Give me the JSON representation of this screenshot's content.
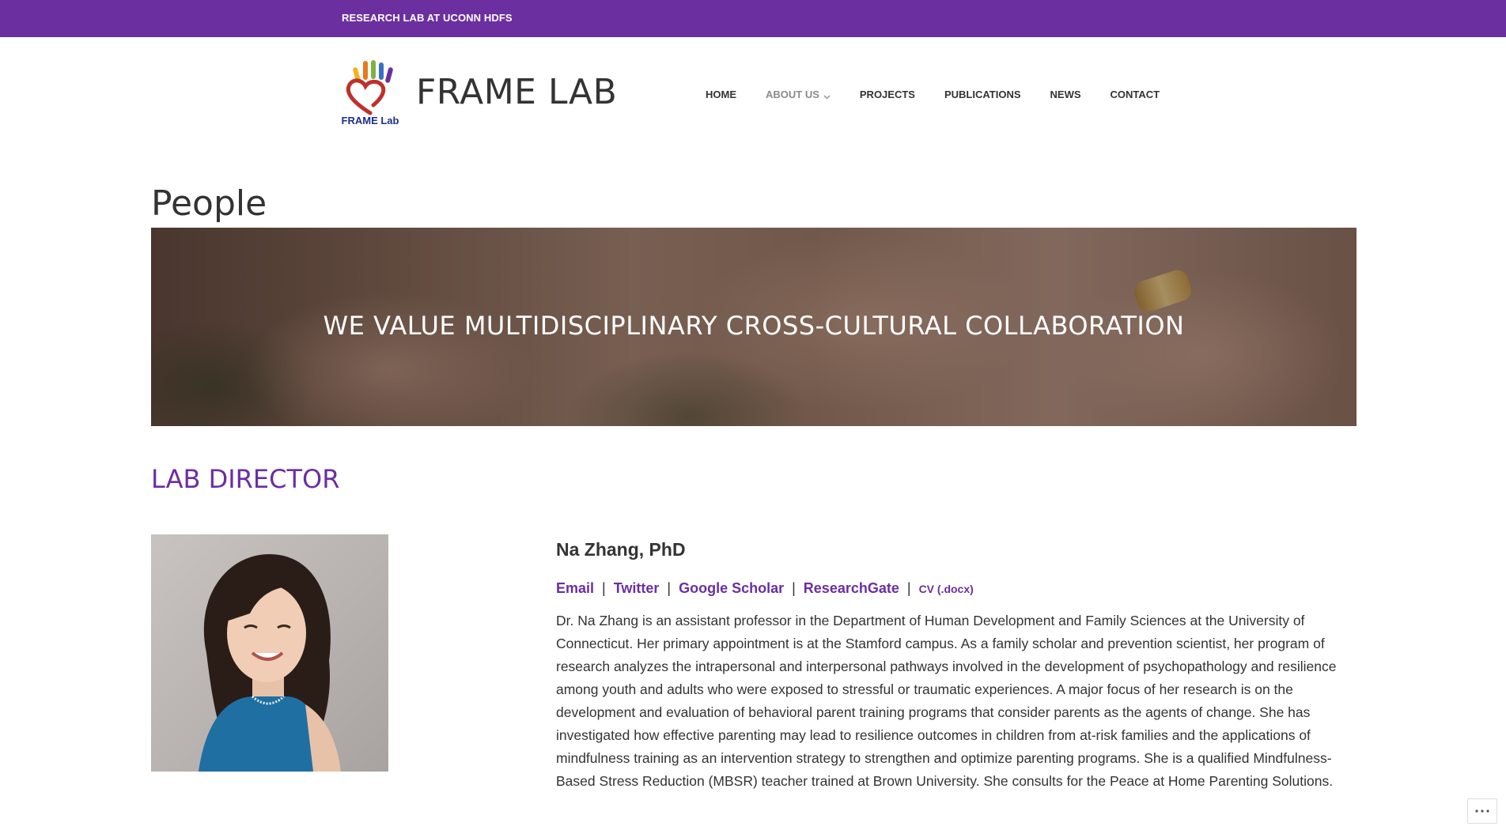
{
  "topbar": {
    "text": "RESEARCH LAB AT UCONN HDFS"
  },
  "header": {
    "logo_label": "FRAME Lab",
    "site_title": "FRAME LAB"
  },
  "nav": {
    "items": [
      {
        "label": "HOME"
      },
      {
        "label": "ABOUT US",
        "active": true,
        "has_dropdown": true
      },
      {
        "label": "PROJECTS"
      },
      {
        "label": "PUBLICATIONS"
      },
      {
        "label": "NEWS"
      },
      {
        "label": "CONTACT"
      }
    ]
  },
  "page": {
    "title": "People",
    "hero_text": "WE VALUE MULTIDISCIPLINARY CROSS-CULTURAL COLLABORATION",
    "section_title": "LAB DIRECTOR"
  },
  "director": {
    "name": "Na Zhang, PhD",
    "links": {
      "email": "Email",
      "twitter": "Twitter",
      "scholar": "Google Scholar",
      "researchgate": "ResearchGate",
      "cv": "CV (.docx)",
      "separator": "|"
    },
    "bio": "Dr. Na Zhang is an assistant professor in the Department of Human Development and Family Sciences at the University of Connecticut. Her primary appointment is at the Stamford campus. As a family scholar and prevention scientist, her program of research analyzes the intrapersonal and interpersonal pathways involved in the development of psychopathology and resilience among youth and adults who were exposed to stressful or traumatic experiences. A major focus of her research is on the development and evaluation of behavioral parent training programs that consider parents as the agents of change. She has investigated how effective parenting may lead to resilience outcomes in children from at-risk families and the applications of mindfulness training as an intervention strategy to strengthen and optimize parenting programs. She is a qualified Mindfulness-Based Stress Reduction (MBSR) teacher trained at Brown University. She consults for the Peace at Home Parenting Solutions."
  },
  "colors": {
    "brand": "#6b2fa0",
    "text": "#333333",
    "nav_active": "#8a8a8a"
  },
  "icons": {
    "more": "ellipsis-icon",
    "dropdown": "chevron-down-icon"
  }
}
